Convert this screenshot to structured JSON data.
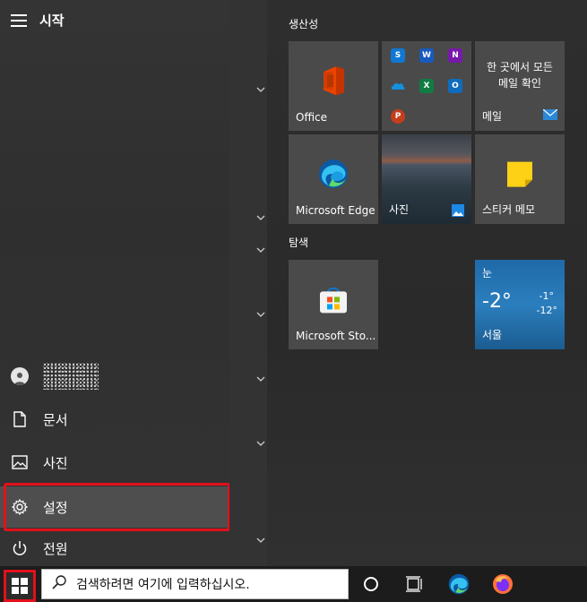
{
  "start_menu": {
    "title": "시작",
    "rail_items": [
      {
        "label": "문서",
        "icon": "document-icon"
      },
      {
        "label": "사진",
        "icon": "photo-icon"
      },
      {
        "label": "설정",
        "icon": "gear-icon"
      },
      {
        "label": "전원",
        "icon": "power-icon"
      }
    ]
  },
  "tile_groups": [
    {
      "title": "생산성"
    },
    {
      "title": "탐색"
    }
  ],
  "tiles": {
    "office": {
      "label": "Office"
    },
    "mail": {
      "label": "메일",
      "line1": "한 곳에서 모든",
      "line2": "메일 확인"
    },
    "edge": {
      "label": "Microsoft Edge"
    },
    "photos": {
      "label": "사진"
    },
    "sticky": {
      "label": "스티커 메모"
    },
    "store": {
      "label": "Microsoft Sto..."
    },
    "weather": {
      "condition": "눈",
      "temp": "-2°",
      "high": "-1°",
      "low": "-12°",
      "city": "서울"
    }
  },
  "office_apps": [
    "skype",
    "word",
    "onenote",
    "onedrive",
    "excel",
    "outlook",
    "powerpoint"
  ],
  "taskbar": {
    "search_placeholder": "검색하려면 여기에 입력하십시오."
  },
  "colors": {
    "highlight": "#e3101a",
    "office_red": "#d83b01",
    "edge_blue": "#0c59a4",
    "weather_blue": "#2b7ebd"
  }
}
